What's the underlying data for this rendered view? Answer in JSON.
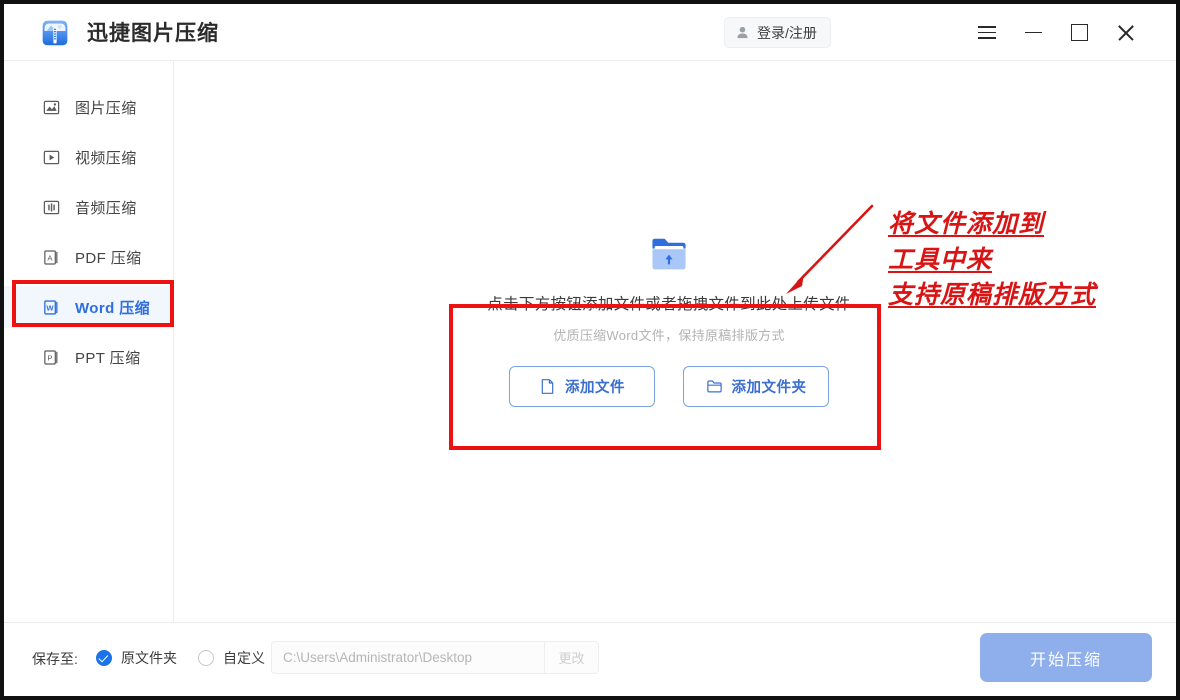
{
  "window": {
    "app_title": "迅捷图片压缩",
    "logo_icon": "compress-bag-icon",
    "login_label": "登录/注册",
    "login_icon": "person-icon",
    "controls": {
      "menu_icon": "hamburger-menu-icon",
      "minimize_icon": "minimize-icon",
      "maximize_icon": "maximize-icon",
      "close_icon": "close-icon"
    }
  },
  "sidebar": {
    "items": [
      {
        "label": "图片压缩",
        "icon": "image-icon",
        "active": false
      },
      {
        "label": "视频压缩",
        "icon": "video-play-icon",
        "active": false
      },
      {
        "label": "音频压缩",
        "icon": "audio-wave-icon",
        "active": false
      },
      {
        "label": "PDF 压缩",
        "icon": "pdf-file-icon",
        "active": false
      },
      {
        "label": "Word 压缩",
        "icon": "word-file-icon",
        "active": true
      },
      {
        "label": "PPT 压缩",
        "icon": "ppt-file-icon",
        "active": false
      }
    ]
  },
  "main": {
    "upload_icon": "folder-upload-icon",
    "drop_title": "点击下方按钮添加文件或者拖拽文件到此处上传文件",
    "drop_subtitle": "优质压缩Word文件，保持原稿排版方式",
    "add_file_label": "添加文件",
    "add_file_icon": "document-icon",
    "add_folder_label": "添加文件夹",
    "add_folder_icon": "folder-icon"
  },
  "annotations": {
    "color": "#ee1111",
    "text_color": "#d81414",
    "lines": [
      "将文件添加到",
      "工具中来",
      "支持原稿排版方式"
    ],
    "arrow_icon": "red-arrow-icon"
  },
  "footer": {
    "save_to_label": "保存至:",
    "option_original": "原文件夹",
    "option_custom": "自定义",
    "selected_option": "原文件夹",
    "path_value": "C:\\Users\\Administrator\\Desktop",
    "change_label": "更改",
    "start_label": "开始压缩",
    "start_color": "#8eafec",
    "radio_color": "#1a73e8"
  }
}
